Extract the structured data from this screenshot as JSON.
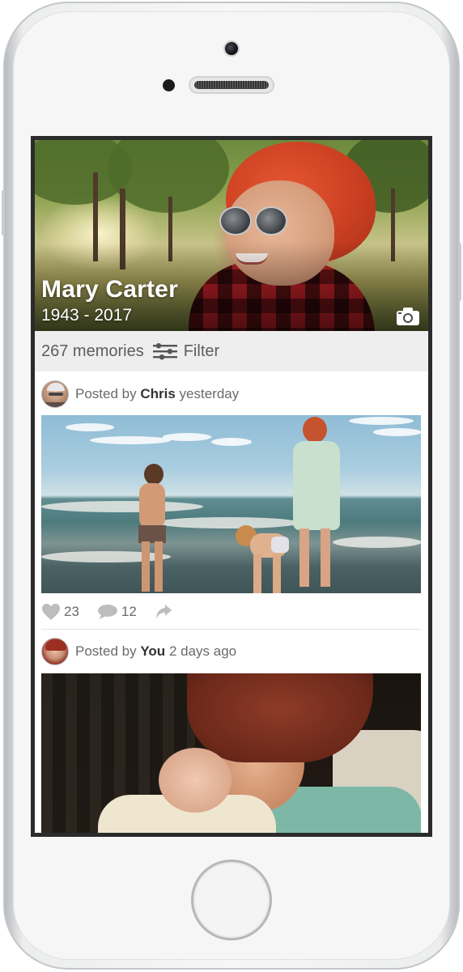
{
  "profile": {
    "name": "Mary Carter",
    "years": "1943 - 2017"
  },
  "filter_bar": {
    "count": "267 memories",
    "filter_label": "Filter"
  },
  "posts": [
    {
      "prefix": "Posted by",
      "author": "Chris",
      "time": "yesterday",
      "likes": "23",
      "comments": "12"
    },
    {
      "prefix": "Posted by",
      "author": "You",
      "time": "2 days ago"
    }
  ],
  "icons": {
    "camera": "camera-icon",
    "filter": "sliders-icon",
    "like": "heart-icon",
    "comment": "speech-bubble-icon",
    "share": "share-arrow-icon"
  },
  "colors": {
    "text_primary": "#333333",
    "text_secondary": "#6a6a6a",
    "filter_bar_bg": "#eeeeee",
    "icon_gray": "#bdbdbd"
  }
}
